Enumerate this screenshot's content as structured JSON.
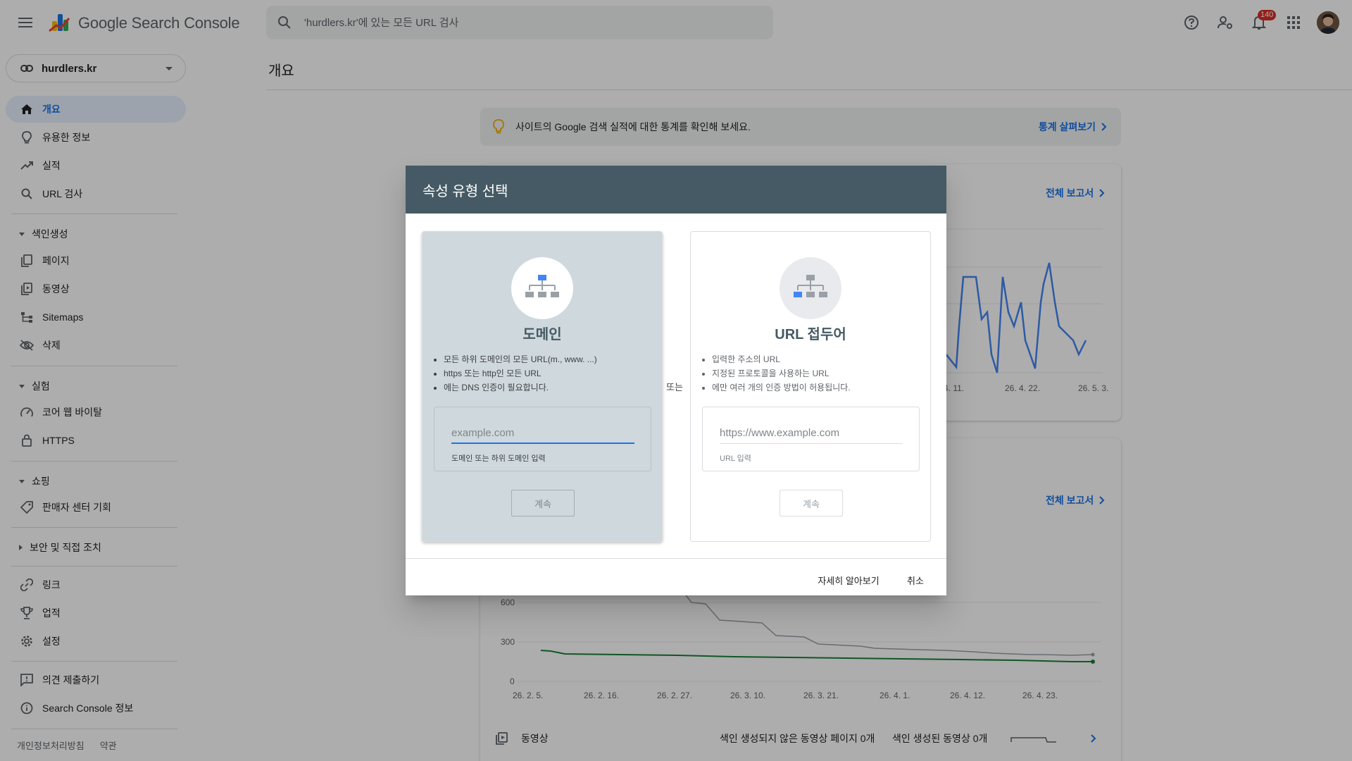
{
  "header": {
    "title": "Google Search Console",
    "search_placeholder": "'hurdlers.kr'에 있는 모든 URL 검사",
    "notification_count": "140"
  },
  "sidebar": {
    "property": "hurdlers.kr",
    "items": [
      {
        "label": "개요",
        "icon": "home-icon"
      },
      {
        "label": "유용한 정보",
        "icon": "lightbulb-icon"
      },
      {
        "label": "실적",
        "icon": "trending-up-icon"
      },
      {
        "label": "URL 검사",
        "icon": "search-icon"
      }
    ],
    "indexing": {
      "header": "색인생성",
      "items": [
        {
          "label": "페이지",
          "icon": "pages-icon"
        },
        {
          "label": "동영상",
          "icon": "video-pages-icon"
        },
        {
          "label": "Sitemaps",
          "icon": "sitemap-icon"
        },
        {
          "label": "삭제",
          "icon": "visibility-off-icon"
        }
      ]
    },
    "experience": {
      "header": "실험",
      "items": [
        {
          "label": "코어 웹 바이탈",
          "icon": "speed-icon"
        },
        {
          "label": "HTTPS",
          "icon": "lock-icon"
        }
      ]
    },
    "shopping": {
      "header": "쇼핑",
      "items": [
        {
          "label": "판매자 센터 기회",
          "icon": "tag-icon"
        }
      ]
    },
    "security": {
      "header": "보안 및 직접 조치"
    },
    "other_items": [
      {
        "label": "링크",
        "icon": "link-icon"
      },
      {
        "label": "업적",
        "icon": "trophy-icon"
      },
      {
        "label": "설정",
        "icon": "gear-icon"
      }
    ],
    "bottom_items": [
      {
        "label": "의견 제출하기",
        "icon": "feedback-icon"
      },
      {
        "label": "Search Console 정보",
        "icon": "info-icon"
      }
    ],
    "footer": {
      "privacy": "개인정보처리방침",
      "terms": "약관"
    }
  },
  "main": {
    "title": "개요",
    "banner": {
      "text": "사이트의 Google 검색 실적에 대한 통계를 확인해 보세요.",
      "link": "통계 살펴보기"
    },
    "performance_card": {
      "link": "전체 보고서",
      "x_ticks": [
        "4. 11.",
        "26. 4. 22.",
        "26. 5. 3."
      ]
    },
    "indexing_card": {
      "link": "전체 보고서",
      "y_ticks": [
        "600",
        "300",
        "0"
      ],
      "x_ticks": [
        "26. 2. 5.",
        "26. 2. 16.",
        "26. 2. 27.",
        "26. 3. 10.",
        "26. 3. 21.",
        "26. 4. 1.",
        "26. 4. 12.",
        "26. 4. 23."
      ]
    },
    "video_row": {
      "label": "동영상",
      "not_indexed": "색인 생성되지 않은 동영상 페이지 0개",
      "indexed": "색인 생성된 동영상 0개"
    }
  },
  "dialog": {
    "title": "속성 유형 선택",
    "or": "또는",
    "domain": {
      "title": "도메인",
      "bullets": [
        "모든 하위 도메인의 모든 URL(m., www. ...)",
        "https 또는 http인 모든 URL",
        "에는 DNS 인증이 필요합니다."
      ],
      "placeholder": "example.com",
      "help": "도메인 또는 하위 도메인 입력",
      "continue": "계속"
    },
    "url_prefix": {
      "title": "URL 접두어",
      "bullets": [
        "입력한 주소의 URL",
        "지정된 프로토콜을 사용하는 URL",
        "에만 여러 개의 인증 방법이 허용됩니다."
      ],
      "placeholder": "https://www.example.com",
      "help": "URL 입력",
      "continue": "계속"
    },
    "learn_more": "자세히 알아보기",
    "cancel": "취소"
  },
  "colors": {
    "header_bar": "#455a64",
    "accent": "#1a73e8",
    "domain_card_bg": "#cfd8dc",
    "alert_red": "#d93025"
  }
}
